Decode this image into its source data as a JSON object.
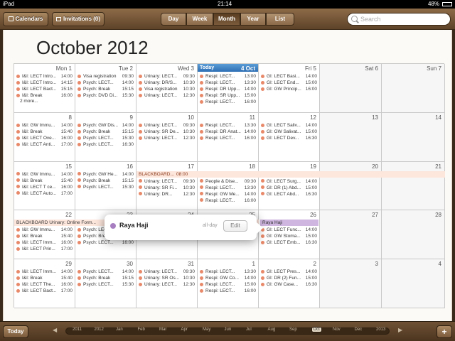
{
  "status_bar": {
    "carrier": "iPad",
    "time": "21:14",
    "battery": "48%"
  },
  "toolbar": {
    "calendars_label": "Calendars",
    "invitations_label": "Invitations (0)",
    "views": [
      "Day",
      "Week",
      "Month",
      "Year",
      "List"
    ],
    "active_view": "Month",
    "search_placeholder": "Search"
  },
  "month_title": "October 2012",
  "weekday_headers": [
    "Mon 1",
    "Tue 2",
    "Wed 3",
    "Thu 4 Oct",
    "Fri 5",
    "Sat 6",
    "Sun 7"
  ],
  "today_label": "Today",
  "weeks": [
    {
      "days": [
        {
          "num": "Mon 1",
          "events": [
            [
              "I&I: LECT Intro...",
              "14:00"
            ],
            [
              "I&I: LECT Intro...",
              "14:15"
            ],
            [
              "I&I: LECT Bact...",
              "15:15"
            ],
            [
              "I&I: Break",
              "16:00"
            ]
          ],
          "more": "2 more..."
        },
        {
          "num": "Tue 2",
          "events": [
            [
              "Visa registration",
              "09:30"
            ],
            [
              "Psych: LECT...",
              "14:00"
            ],
            [
              "Psych: Break",
              "15:15"
            ],
            [
              "Psych: DVD Di...",
              "15:30"
            ]
          ]
        },
        {
          "num": "Wed 3",
          "events": [
            [
              "Urinary: LECT...",
              "09:30"
            ],
            [
              "Urinary: DR/S...",
              "10:30"
            ],
            [
              "Visa registration",
              "10:30"
            ],
            [
              "Urinary: LECT...",
              "12:30"
            ]
          ]
        },
        {
          "num": "4 Oct",
          "today": true,
          "events": [
            [
              "Respi: LECT...",
              "13:00"
            ],
            [
              "Respi: LECT...",
              "13:30"
            ],
            [
              "Respi: DR Upp...",
              "14:00"
            ],
            [
              "Respi: SR Upp...",
              "15:00"
            ],
            [
              "Respi: LECT...",
              "16:00"
            ]
          ]
        },
        {
          "num": "Fri 5",
          "events": [
            [
              "GI: LECT Basi...",
              "14:00"
            ],
            [
              "GI: LECT End...",
              "15:00"
            ],
            [
              "GI: GW Princip...",
              "16:00"
            ]
          ]
        },
        {
          "num": "Sat 6",
          "weekend": true,
          "events": []
        },
        {
          "num": "Sun 7",
          "weekend": true,
          "events": []
        }
      ]
    },
    {
      "days": [
        {
          "num": "8",
          "events": [
            [
              "I&I: GW Immu...",
              "14:00"
            ],
            [
              "I&I: Break",
              "15:40"
            ],
            [
              "I&I: LECT Ove...",
              "16:00"
            ],
            [
              "I&I: LECT Anti...",
              "17:00"
            ]
          ]
        },
        {
          "num": "9",
          "events": [
            [
              "Psych: GW Dis...",
              "14:00"
            ],
            [
              "Psych: Break",
              "15:15"
            ],
            [
              "Psych: LECT...",
              "15:30"
            ],
            [
              "Psych: LECT...",
              "16:30"
            ]
          ]
        },
        {
          "num": "10",
          "events": [
            [
              "Urinary: LECT...",
              "09:30"
            ],
            [
              "Urinary: SR De...",
              "10:30"
            ],
            [
              "Urinary: LECT...",
              "12:30"
            ]
          ]
        },
        {
          "num": "11",
          "events": [
            [
              "Respi: LECT...",
              "13:30"
            ],
            [
              "Respi: DR Anat...",
              "14:00"
            ],
            [
              "Respi: LECT...",
              "16:00"
            ]
          ]
        },
        {
          "num": "12",
          "events": [
            [
              "GI: LECT Saliv...",
              "14:00"
            ],
            [
              "GI: GW Salivat...",
              "15:00"
            ],
            [
              "GI: LECT Dev...",
              "16:30"
            ]
          ]
        },
        {
          "num": "13",
          "weekend": true,
          "events": []
        },
        {
          "num": "14",
          "weekend": true,
          "events": []
        }
      ]
    },
    {
      "days": [
        {
          "num": "15",
          "events": [
            [
              "I&I: GW Immu...",
              "14:00"
            ],
            [
              "I&I: Break",
              "15:40"
            ],
            [
              "I&I: LECT T ce...",
              "16:00"
            ],
            [
              "I&I: LECT Auto...",
              "17:00"
            ]
          ]
        },
        {
          "num": "16",
          "events": [
            [
              "Psych: GW He...",
              "14:00"
            ],
            [
              "Psych: Break",
              "15:15"
            ],
            [
              "Psych: LECT...",
              "15:30"
            ]
          ]
        },
        {
          "num": "17",
          "events": [
            [
              "Urinary: LECT...",
              "09:30"
            ],
            [
              "Urinary: SR Fi...",
              "10:30"
            ],
            [
              "Urinary: DR...",
              "12:30"
            ]
          ]
        },
        {
          "num": "18",
          "events": [
            [
              "People & Dise...",
              "09:30"
            ],
            [
              "Respi: LECT...",
              "13:30"
            ],
            [
              "Respi: GW Me...",
              "14:00"
            ],
            [
              "Respi: LECT...",
              "16:00"
            ]
          ]
        },
        {
          "num": "19",
          "events": [
            [
              "GI: LECT Surg...",
              "14:00"
            ],
            [
              "GI: DR (1) Abd...",
              "15:00"
            ],
            [
              "GI: LECT Abd...",
              "16:30"
            ]
          ]
        },
        {
          "num": "20",
          "weekend": true,
          "events": []
        },
        {
          "num": "21",
          "weekend": true,
          "events": []
        }
      ]
    },
    {
      "days": [
        {
          "num": "22",
          "events": [
            [
              "I&I: GW Immu...",
              "14:00"
            ],
            [
              "I&I: Break",
              "15:40"
            ],
            [
              "I&I: LECT Imm...",
              "16:00"
            ],
            [
              "I&I: LECT Prin...",
              "17:00"
            ]
          ]
        },
        {
          "num": "23",
          "events": [
            [
              "Psych: LECT...",
              "14:00"
            ],
            [
              "Psych: Break",
              "15:15"
            ],
            [
              "Psych: LECT...",
              "16:00"
            ]
          ]
        },
        {
          "num": "24",
          "events": []
        },
        {
          "num": "25",
          "events": [
            [
              "Respi: LECT...",
              "16:00"
            ]
          ]
        },
        {
          "num": "26",
          "events": [
            [
              "GI: LECT Func...",
              "14:00"
            ],
            [
              "GI: GW Stoma...",
              "15:00"
            ],
            [
              "GI: LECT Emb...",
              "16:30"
            ]
          ]
        },
        {
          "num": "27",
          "weekend": true,
          "events": []
        },
        {
          "num": "28",
          "weekend": true,
          "events": []
        }
      ]
    },
    {
      "days": [
        {
          "num": "29",
          "events": [
            [
              "I&I: LECT Imm...",
              "14:00"
            ],
            [
              "I&I: Break",
              "15:40"
            ],
            [
              "I&I: LECT The...",
              "16:00"
            ],
            [
              "I&I: LECT Bact...",
              "17:00"
            ]
          ]
        },
        {
          "num": "30",
          "events": [
            [
              "Psych: LECT...",
              "14:00"
            ],
            [
              "Psych: Break",
              "15:15"
            ],
            [
              "Psych: LECT...",
              "15:30"
            ]
          ]
        },
        {
          "num": "31",
          "events": [
            [
              "Urinary: LECT...",
              "09:30"
            ],
            [
              "Urinary: SR Os...",
              "10:30"
            ],
            [
              "Urinary: LECT...",
              "12:30"
            ]
          ]
        },
        {
          "num": "1",
          "events": [
            [
              "Respi: LECT...",
              "13:30"
            ],
            [
              "Respi: GW Co...",
              "14:00"
            ],
            [
              "Respi: LECT...",
              "15:00"
            ],
            [
              "Respi: LECT...",
              "16:00"
            ]
          ]
        },
        {
          "num": "2",
          "events": [
            [
              "GI: LECT Pres...",
              "14:00"
            ],
            [
              "GI: DR (2) Fun...",
              "15:00"
            ],
            [
              "GI: GW Case...",
              "16:30"
            ]
          ]
        },
        {
          "num": "3",
          "weekend": true,
          "events": []
        },
        {
          "num": "4",
          "weekend": true,
          "events": []
        }
      ]
    }
  ],
  "bands": {
    "blackboard_17": {
      "label": "BLACKBOARD...",
      "time": "08:00"
    },
    "blackboard_22": {
      "label": "BLACKBOARD Urinary: Online Form..."
    },
    "raya_26": {
      "label": "Raya Haji"
    }
  },
  "popover": {
    "name": "Raya Haji",
    "allday": "all-day",
    "edit_label": "Edit",
    "dot_color": "#a77fc1"
  },
  "bottom": {
    "today_label": "Today",
    "add_label": "+",
    "timeline": [
      "2011",
      "2012",
      "Jan",
      "Feb",
      "Mar",
      "Apr",
      "May",
      "Jun",
      "Jul",
      "Aug",
      "Sep",
      "Oct",
      "Nov",
      "Dec",
      "2013"
    ],
    "active_month": "Oct"
  },
  "colors": {
    "event_dot": "#e8896a",
    "today_header": "#2e6fb4",
    "band_orange": "#fde6dc",
    "band_purple": "#cfb6e0"
  }
}
